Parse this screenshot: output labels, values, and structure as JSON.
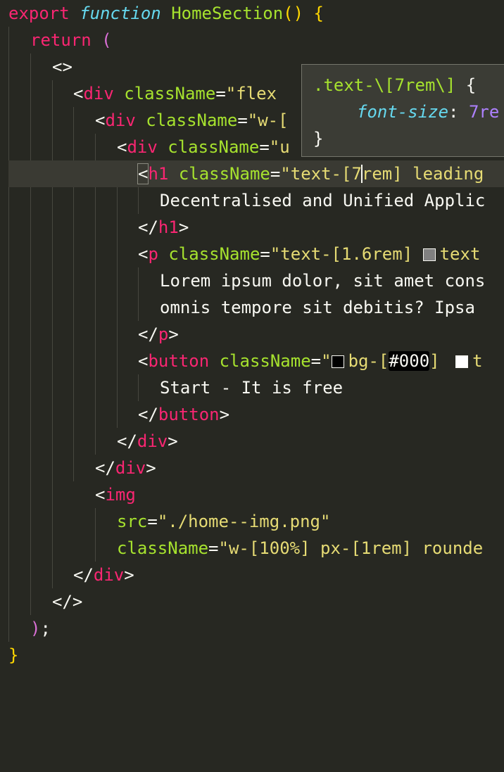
{
  "editor": {
    "lines": {
      "l1": {
        "kw": "export",
        "func": "function",
        "name": "HomeSection",
        "parens": "()",
        "brace": "{"
      },
      "l2": {
        "kw": "return",
        "paren": "("
      },
      "l3": {
        "frag": "<>"
      },
      "l4": {
        "open": "<",
        "tag": "div",
        "attr": "className",
        "eq": "=",
        "str": "\"flex"
      },
      "l5": {
        "open": "<",
        "tag": "div",
        "attr": "className",
        "eq": "=",
        "str": "\"w-["
      },
      "l6": {
        "open": "<",
        "tag": "div",
        "attr": "className",
        "eq": "=",
        "str": "\"u"
      },
      "l7": {
        "open": "<",
        "tag": "h1",
        "attr": "className",
        "eq": "=",
        "str_a": "\"text-[7",
        "str_b": "rem] leading"
      },
      "l8": {
        "text": "Decentralised and Unified Applic"
      },
      "l9": {
        "close": "</",
        "tag": "h1",
        "end": ">"
      },
      "l10": {
        "open": "<",
        "tag": "p",
        "attr": "className",
        "eq": "=",
        "str": "\"text-[1.6rem] ",
        "str2": "text"
      },
      "l11": {
        "text": "Lorem ipsum dolor, sit amet cons"
      },
      "l12": {
        "text": "omnis tempore sit debitis? Ipsa "
      },
      "l13": {
        "close": "</",
        "tag": "p",
        "end": ">"
      },
      "l14": {
        "open": "<",
        "tag": "button",
        "attr": "className",
        "eq": "=",
        "q": "\"",
        "s1": "bg-[",
        "hex": "#000",
        "s2": "] ",
        "s3": "t"
      },
      "l15": {
        "text": "Start - It is free"
      },
      "l16": {
        "close": "</",
        "tag": "button",
        "end": ">"
      },
      "l17": {
        "close": "</",
        "tag": "div",
        "end": ">"
      },
      "l18": {
        "close": "</",
        "tag": "div",
        "end": ">"
      },
      "l19": {
        "open": "<",
        "tag": "img"
      },
      "l20": {
        "attr": "src",
        "eq": "=",
        "str": "\"./home--img.png\""
      },
      "l21": {
        "attr": "className",
        "eq": "=",
        "str": "\"w-[100%] px-[1rem] rounde"
      },
      "l22": {
        "close": "</",
        "tag": "div",
        "end": ">"
      },
      "l23": {
        "frag": "</>"
      },
      "l24": {
        "paren": ")",
        "semi": ";"
      },
      "l25": {
        "brace": "}"
      }
    },
    "swatch_colors": {
      "gray": "#808080",
      "black": "#000000",
      "white": "#ffffff"
    }
  },
  "hover": {
    "selector": ".text-\\[7rem\\]",
    "open_brace": "{",
    "property": "font-size",
    "colon": ": ",
    "value": "7re",
    "close_brace": "}"
  }
}
